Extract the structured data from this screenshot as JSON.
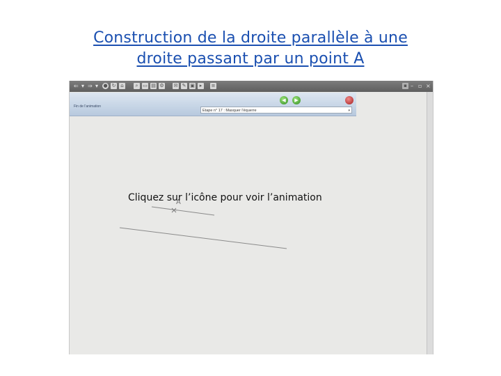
{
  "title": {
    "line1": "Construction de la droite parallèle à une",
    "line2": "droite passant par un point A"
  },
  "window": {
    "controls": [
      "–",
      "▫",
      "×"
    ]
  },
  "panel": {
    "label": "Fin de l'animation",
    "step": "Etape n° 17 : Masquer l'équerre"
  },
  "figure": {
    "point_label": "A"
  },
  "caption": "Cliquez sur l’icône pour voir l’animation",
  "icons": [
    "back-arrow-icon",
    "forward-arrow-icon",
    "stop-icon",
    "refresh-icon",
    "home-icon",
    "search-icon",
    "print-icon",
    "settings-icon",
    "play-icon",
    "green-prev-icon",
    "green-next-icon",
    "red-stop-icon"
  ],
  "colors": {
    "title": "#1a4fb0",
    "nav_green": "#2f8d1e",
    "stop_red": "#a51e1e"
  }
}
